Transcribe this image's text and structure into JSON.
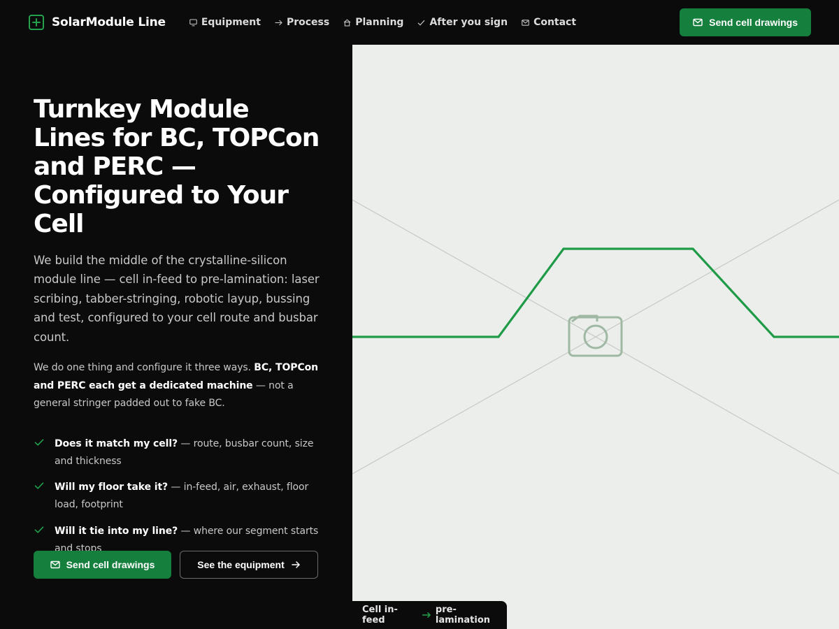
{
  "brand": {
    "name": "SolarModule Line",
    "icon": "plus-square-icon",
    "accent_color": "#15803d",
    "accent_light": "#22a04b"
  },
  "nav": {
    "items": [
      {
        "label": "Equipment",
        "icon": "monitor-icon"
      },
      {
        "label": "Process",
        "icon": "arrow-right-icon"
      },
      {
        "label": "Planning",
        "icon": "home-icon"
      },
      {
        "label": "After you sign",
        "icon": "check-icon"
      },
      {
        "label": "Contact",
        "icon": "mail-icon"
      }
    ],
    "cta_label": "Send cell drawings",
    "cta_icon": "mail-icon"
  },
  "hero": {
    "title": "Turnkey Module Lines for BC, TOPCon and PERC — Configured to Your Cell",
    "lead": "We build the middle of the crystalline-silicon module line — cell in-feed to pre-lamination: laser scribing, tabber-stringing, robotic layup, bussing and test, configured to your cell route and busbar count.",
    "note_before": "We do one thing and configure it three ways. ",
    "note_strong": "BC, TOPCon and PERC each get a dedicated machine",
    "note_after": " — not a general stringer padded out to fake BC.",
    "checklist": [
      {
        "strong": "Does it match my cell?",
        "text": " — route, busbar count, size and thickness"
      },
      {
        "strong": "Will my floor take it?",
        "text": " — in-feed, air, exhaust, floor load, footprint"
      },
      {
        "strong": "Will it tie into my line?",
        "text": " — where our segment starts and stops"
      }
    ],
    "primary_cta": "Send cell drawings",
    "secondary_cta": "See the equipment"
  },
  "media": {
    "placeholder_icon": "camera-icon",
    "caption_start": "Cell in-feed",
    "caption_arrow": "→",
    "caption_end": "pre-lamination",
    "background_color": "#eceeeb",
    "line_color": "#1f9a47"
  }
}
